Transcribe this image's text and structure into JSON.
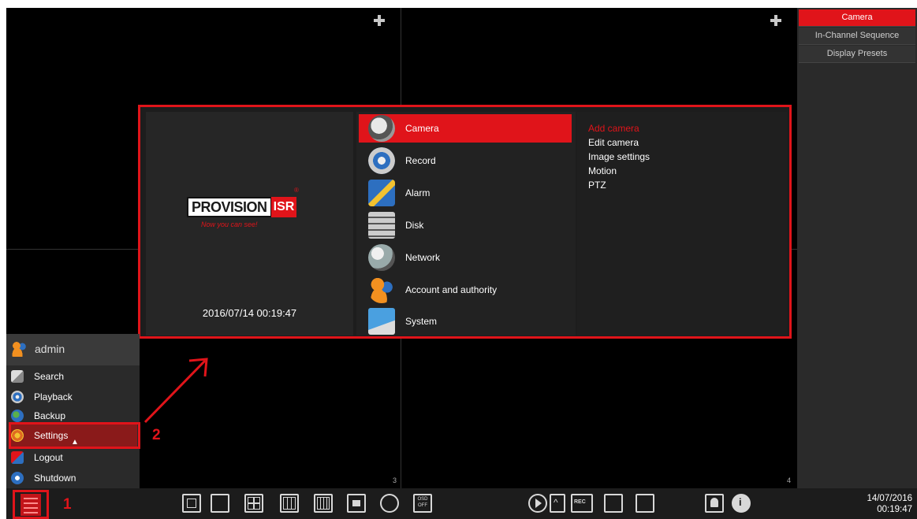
{
  "right_panel": {
    "items": [
      {
        "label": "Camera",
        "active": true
      },
      {
        "label": "In-Channel Sequence",
        "active": false
      },
      {
        "label": "Display Presets",
        "active": false
      }
    ]
  },
  "tiles": {
    "numbers": [
      "3",
      "4"
    ]
  },
  "settings_menu": {
    "brand": {
      "name": "PROVISION",
      "mark": "ISR",
      "tagline": "Now you can see!",
      "registered": "®"
    },
    "datetime": "2016/07/14 00:19:47",
    "items": [
      {
        "label": "Camera",
        "icon": "camera-icon",
        "active": true
      },
      {
        "label": "Record",
        "icon": "record-reel-icon",
        "active": false
      },
      {
        "label": "Alarm",
        "icon": "alarm-bolt-icon",
        "active": false
      },
      {
        "label": "Disk",
        "icon": "disk-stack-icon",
        "active": false
      },
      {
        "label": "Network",
        "icon": "network-globe-icon",
        "active": false
      },
      {
        "label": "Account and authority",
        "icon": "users-icon",
        "active": false
      },
      {
        "label": "System",
        "icon": "system-gear-icon",
        "active": false
      }
    ],
    "subitems": [
      {
        "label": "Add camera",
        "active": true
      },
      {
        "label": "Edit camera",
        "active": false
      },
      {
        "label": "Image settings",
        "active": false
      },
      {
        "label": "Motion",
        "active": false
      },
      {
        "label": "PTZ",
        "active": false
      }
    ]
  },
  "user_menu": {
    "username": "admin",
    "items": [
      {
        "label": "Search",
        "icon": "search-icon"
      },
      {
        "label": "Playback",
        "icon": "playback-icon"
      },
      {
        "label": "Backup",
        "icon": "backup-icon"
      },
      {
        "label": "Settings",
        "icon": "settings-icon",
        "highlighted": true
      },
      {
        "label": "Logout",
        "icon": "logout-icon"
      },
      {
        "label": "Shutdown",
        "icon": "shutdown-icon"
      }
    ]
  },
  "annotations": {
    "step1": "1",
    "step2": "2"
  },
  "toolbar": {
    "osd_label_top": "OSD",
    "osd_label_bottom": "OFF",
    "rec_label": "REC",
    "date": "14/07/2016",
    "time": "00:19:47"
  },
  "colors": {
    "accent": "#e0141a",
    "background": "#000000",
    "panel": "#2a2a2a"
  }
}
